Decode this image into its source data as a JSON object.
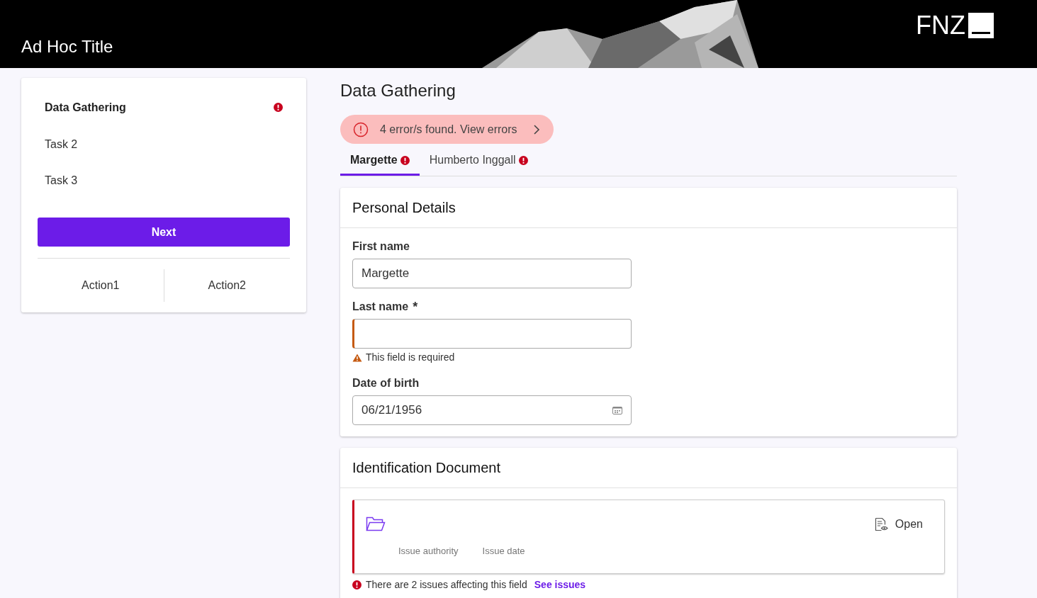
{
  "header": {
    "title": "Ad Hoc Title",
    "logo": "FNZ"
  },
  "tasks": [
    {
      "label": "Data Gathering",
      "selected": true,
      "error": true
    },
    {
      "label": "Task 2",
      "selected": false,
      "error": false
    },
    {
      "label": "Task 3",
      "selected": false,
      "error": false
    }
  ],
  "next_button": "Next",
  "actions": [
    "Action1",
    "Action2"
  ],
  "page_title": "Data Gathering",
  "error_banner": {
    "text": "4 error/s found.  View errors"
  },
  "tabs": [
    {
      "label": "Margette",
      "selected": true,
      "error": true
    },
    {
      "label": "Humberto Inggall",
      "selected": false,
      "error": true
    }
  ],
  "personal_details": {
    "title": "Personal Details",
    "fields": [
      {
        "kind": "text",
        "label": "First name",
        "value": "Margette"
      },
      {
        "kind": "text",
        "label": "Last name",
        "required_mark": "*",
        "error": "This field is required"
      },
      {
        "kind": "date",
        "label": "Date of birth",
        "value": "06/21/1956"
      }
    ]
  },
  "identification": {
    "title": "Identification Document",
    "open_label": "Open",
    "columns": [
      "Issue authority",
      "Issue date"
    ],
    "issues_text": "There are 2 issues affecting this field",
    "issues_link": "See issues"
  }
}
